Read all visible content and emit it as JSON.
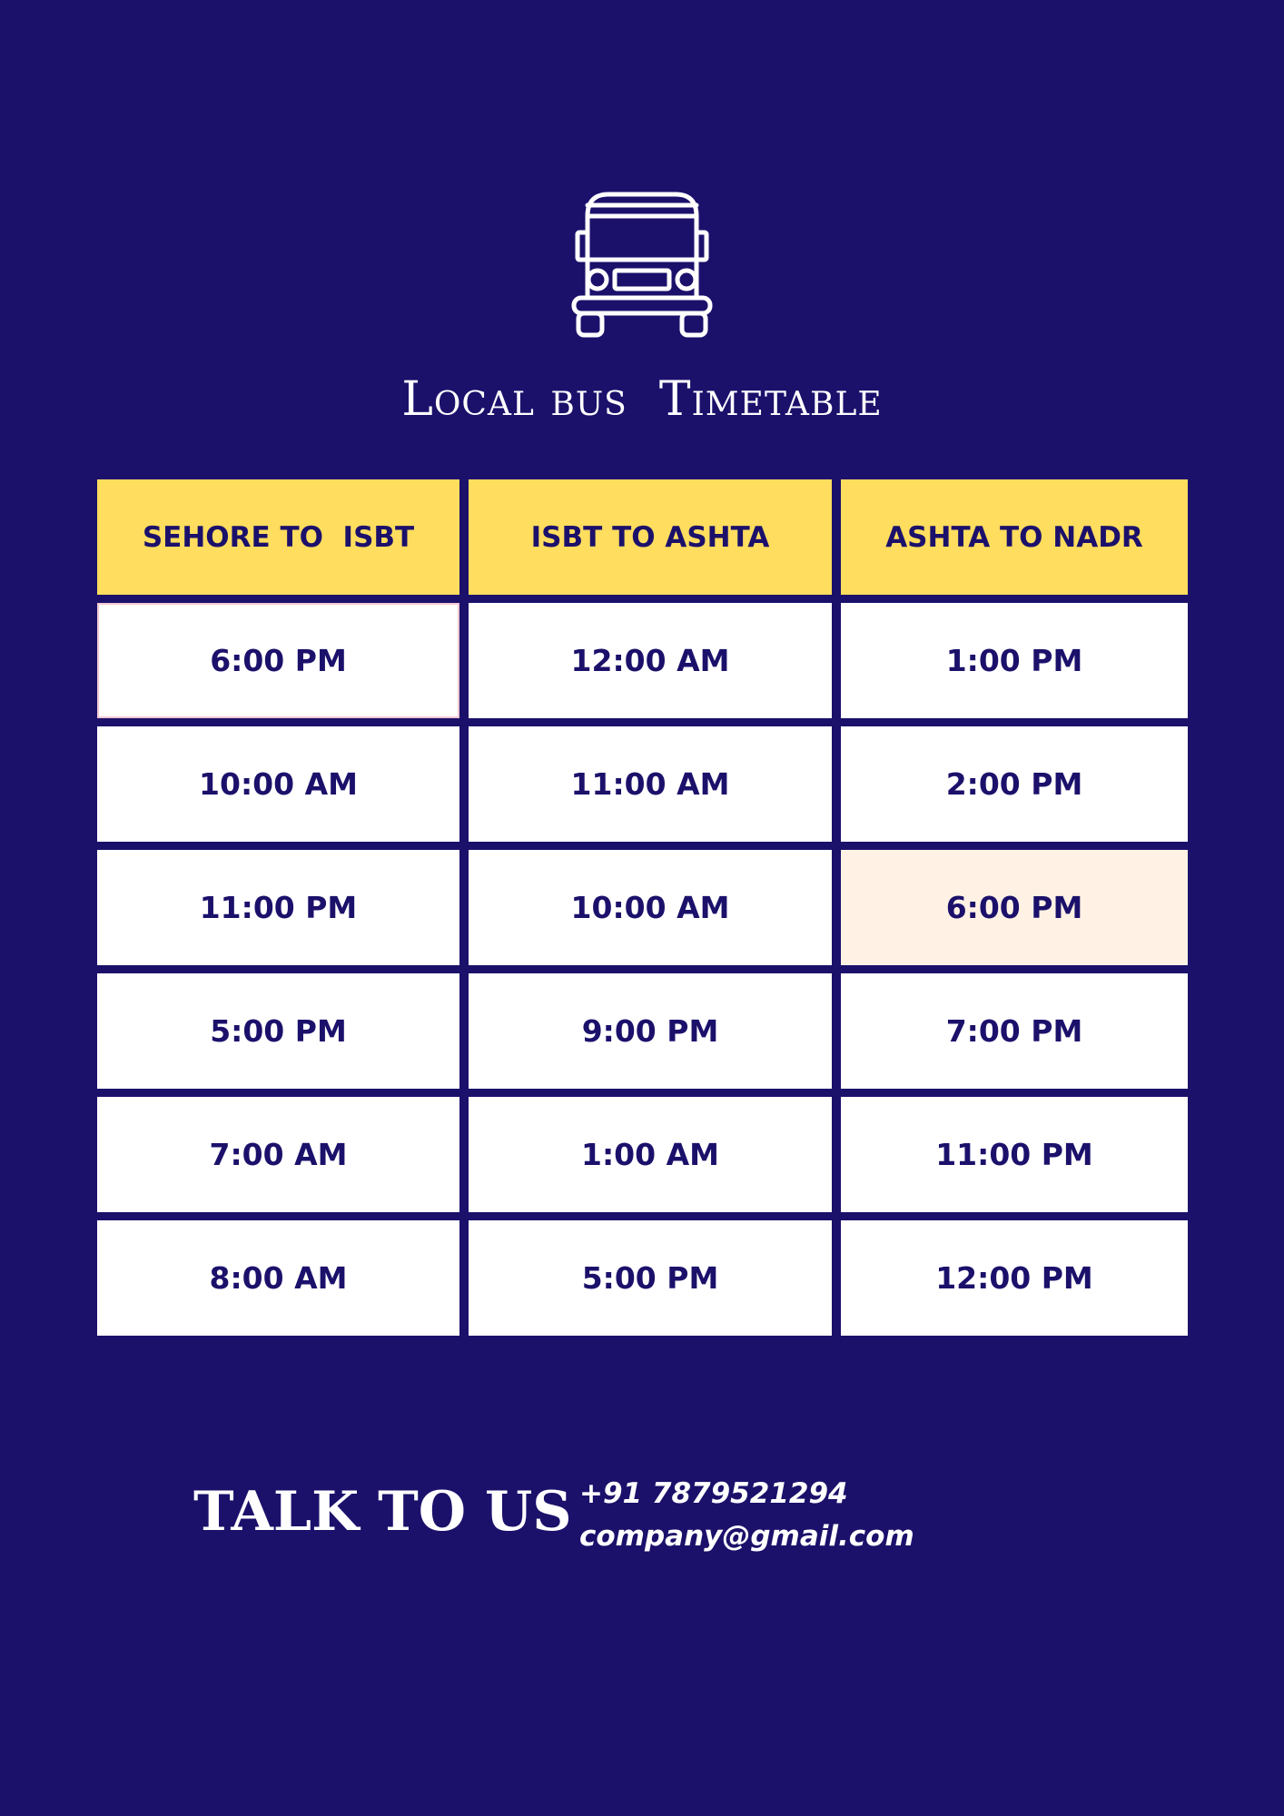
{
  "colors": {
    "background": "#1b116b",
    "header_fill": "#ffdd5e",
    "cell_fill": "#ffffff",
    "highlight_fill": "#fff2e5",
    "text_dark": "#1b116b",
    "text_light": "#ffffff"
  },
  "icon": "bus-icon",
  "title": "Local bus  Timetable",
  "table": {
    "headers": [
      "SEHORE TO  ISBT",
      "ISBT TO ASHTA",
      "ASHTA TO NADR"
    ],
    "rows": [
      [
        "6:00 PM",
        "12:00 AM",
        "1:00 PM"
      ],
      [
        "10:00 AM",
        "11:00 AM",
        "2:00 PM"
      ],
      [
        "11:00 PM",
        "10:00 AM",
        "6:00 PM"
      ],
      [
        "5:00 PM",
        "9:00 PM",
        "7:00 PM"
      ],
      [
        "7:00 AM",
        "1:00 AM",
        "11:00 PM"
      ],
      [
        "8:00 AM",
        "5:00 PM",
        "12:00 PM"
      ]
    ]
  },
  "contact": {
    "heading": "TALK TO US",
    "phone": "+91 7879521294",
    "email": "company@gmail.com"
  }
}
